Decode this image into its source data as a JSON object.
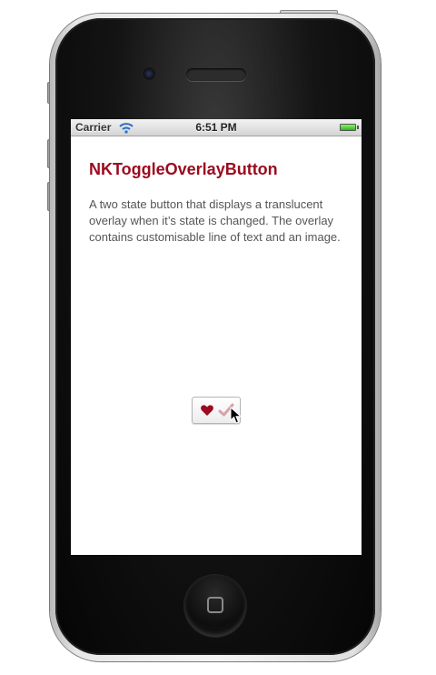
{
  "status_bar": {
    "carrier": "Carrier",
    "time": "6:51 PM"
  },
  "content": {
    "title": "NKToggleOverlayButton",
    "description": "A two state button that displays a translucent overlay when it’s state is changed. The overlay contains customisable line of text and an image."
  },
  "toggle": {
    "state": "off",
    "icons": [
      "heart-icon",
      "check-icon"
    ]
  },
  "colors": {
    "title": "#9b0a1e",
    "heart": "#9b0a1e",
    "check": "#d6a3aa",
    "battery": "#2fb51a"
  }
}
